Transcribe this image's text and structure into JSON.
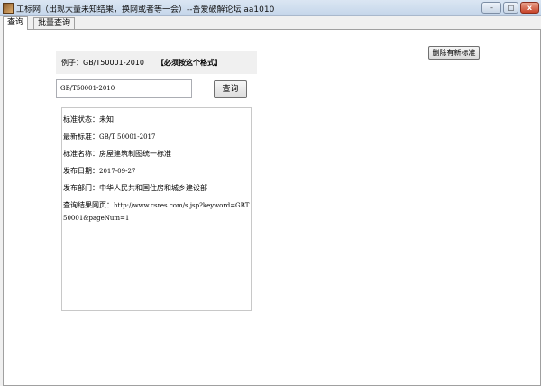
{
  "window": {
    "title": "工标网（出现大量未知结果，换网或者等一会）--吾爱破解论坛 aa1010",
    "minimize": "–",
    "maximize": "□",
    "close": "x"
  },
  "tabs": [
    {
      "label": "查询"
    },
    {
      "label": "批量查询"
    }
  ],
  "example": {
    "text": "例子：GB/T50001-2010",
    "note": "【必须按这个格式】"
  },
  "search": {
    "value": "GB/T50001-2010",
    "button": "查询"
  },
  "delete_button": "删除有新标准",
  "result": {
    "status_label": "标准状态：",
    "status": "未知",
    "latest_label": "最新标准：",
    "latest": "GB/T 50001-2017",
    "name_label": "标准名称：",
    "name": "房屋建筑制图统一标准",
    "date_label": "发布日期：",
    "date": "2017-09-27",
    "dept_label": "发布部门：",
    "dept": "中华人民共和国住房和城乡建设部",
    "url_label": "查询结果网页：",
    "url": "http://www.csres.com/s.jsp?keyword=GBT50001&pageNum=1"
  }
}
